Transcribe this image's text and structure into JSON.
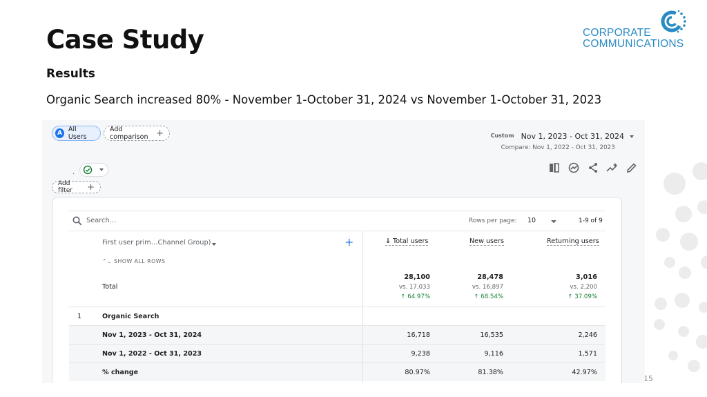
{
  "slide": {
    "title": "Case Study",
    "subtitle": "Results",
    "description": "Organic Search increased 80% - November 1-October 31, 2024 vs November 1-October 31, 2023",
    "page_number": "15"
  },
  "logo": {
    "line1": "CORPORATE",
    "line2": "COMMUNICATIONS",
    "color": "#2a8bc4"
  },
  "report": {
    "segment_chip": {
      "avatar": "A",
      "label": "All Users"
    },
    "add_comparison": "Add comparison",
    "date": {
      "custom_label": "Custom",
      "range": "Nov 1, 2023 - Oct 31, 2024",
      "compare": "Compare: Nov 1, 2022 - Oct 31, 2023"
    },
    "add_filter": "Add filter",
    "toolbar_icons": [
      "compare-columns-icon",
      "insights-icon",
      "share-icon",
      "trend-icon",
      "edit-icon"
    ],
    "table": {
      "search_placeholder": "Search…",
      "rows_per_page_label": "Rows per page:",
      "rows_per_page_value": "10",
      "pagination": "1-9 of 9",
      "dimension_header": "First user prim…Channel Group)",
      "show_all_rows": "SHOW ALL ROWS",
      "columns": [
        "Total users",
        "New users",
        "Returning users"
      ],
      "sort_arrow": "↓",
      "totals": {
        "label": "Total",
        "values": [
          {
            "main": "28,100",
            "vs": "vs. 17,033",
            "change": "↑ 64.97%"
          },
          {
            "main": "28,478",
            "vs": "vs. 16,897",
            "change": "↑ 68.54%"
          },
          {
            "main": "3,016",
            "vs": "vs. 2,200",
            "change": "↑ 37.09%"
          }
        ]
      },
      "rows": [
        {
          "index": "1",
          "label": "Organic Search",
          "values": [
            "",
            "",
            ""
          ]
        },
        {
          "index": "",
          "label": "Nov 1, 2023 - Oct 31, 2024",
          "values": [
            "16,718",
            "16,535",
            "2,246"
          ]
        },
        {
          "index": "",
          "label": "Nov 1, 2022 - Oct 31, 2023",
          "values": [
            "9,238",
            "9,116",
            "1,571"
          ]
        },
        {
          "index": "",
          "label": "% change",
          "values": [
            "80.97%",
            "81.38%",
            "42.97%"
          ]
        }
      ]
    }
  }
}
